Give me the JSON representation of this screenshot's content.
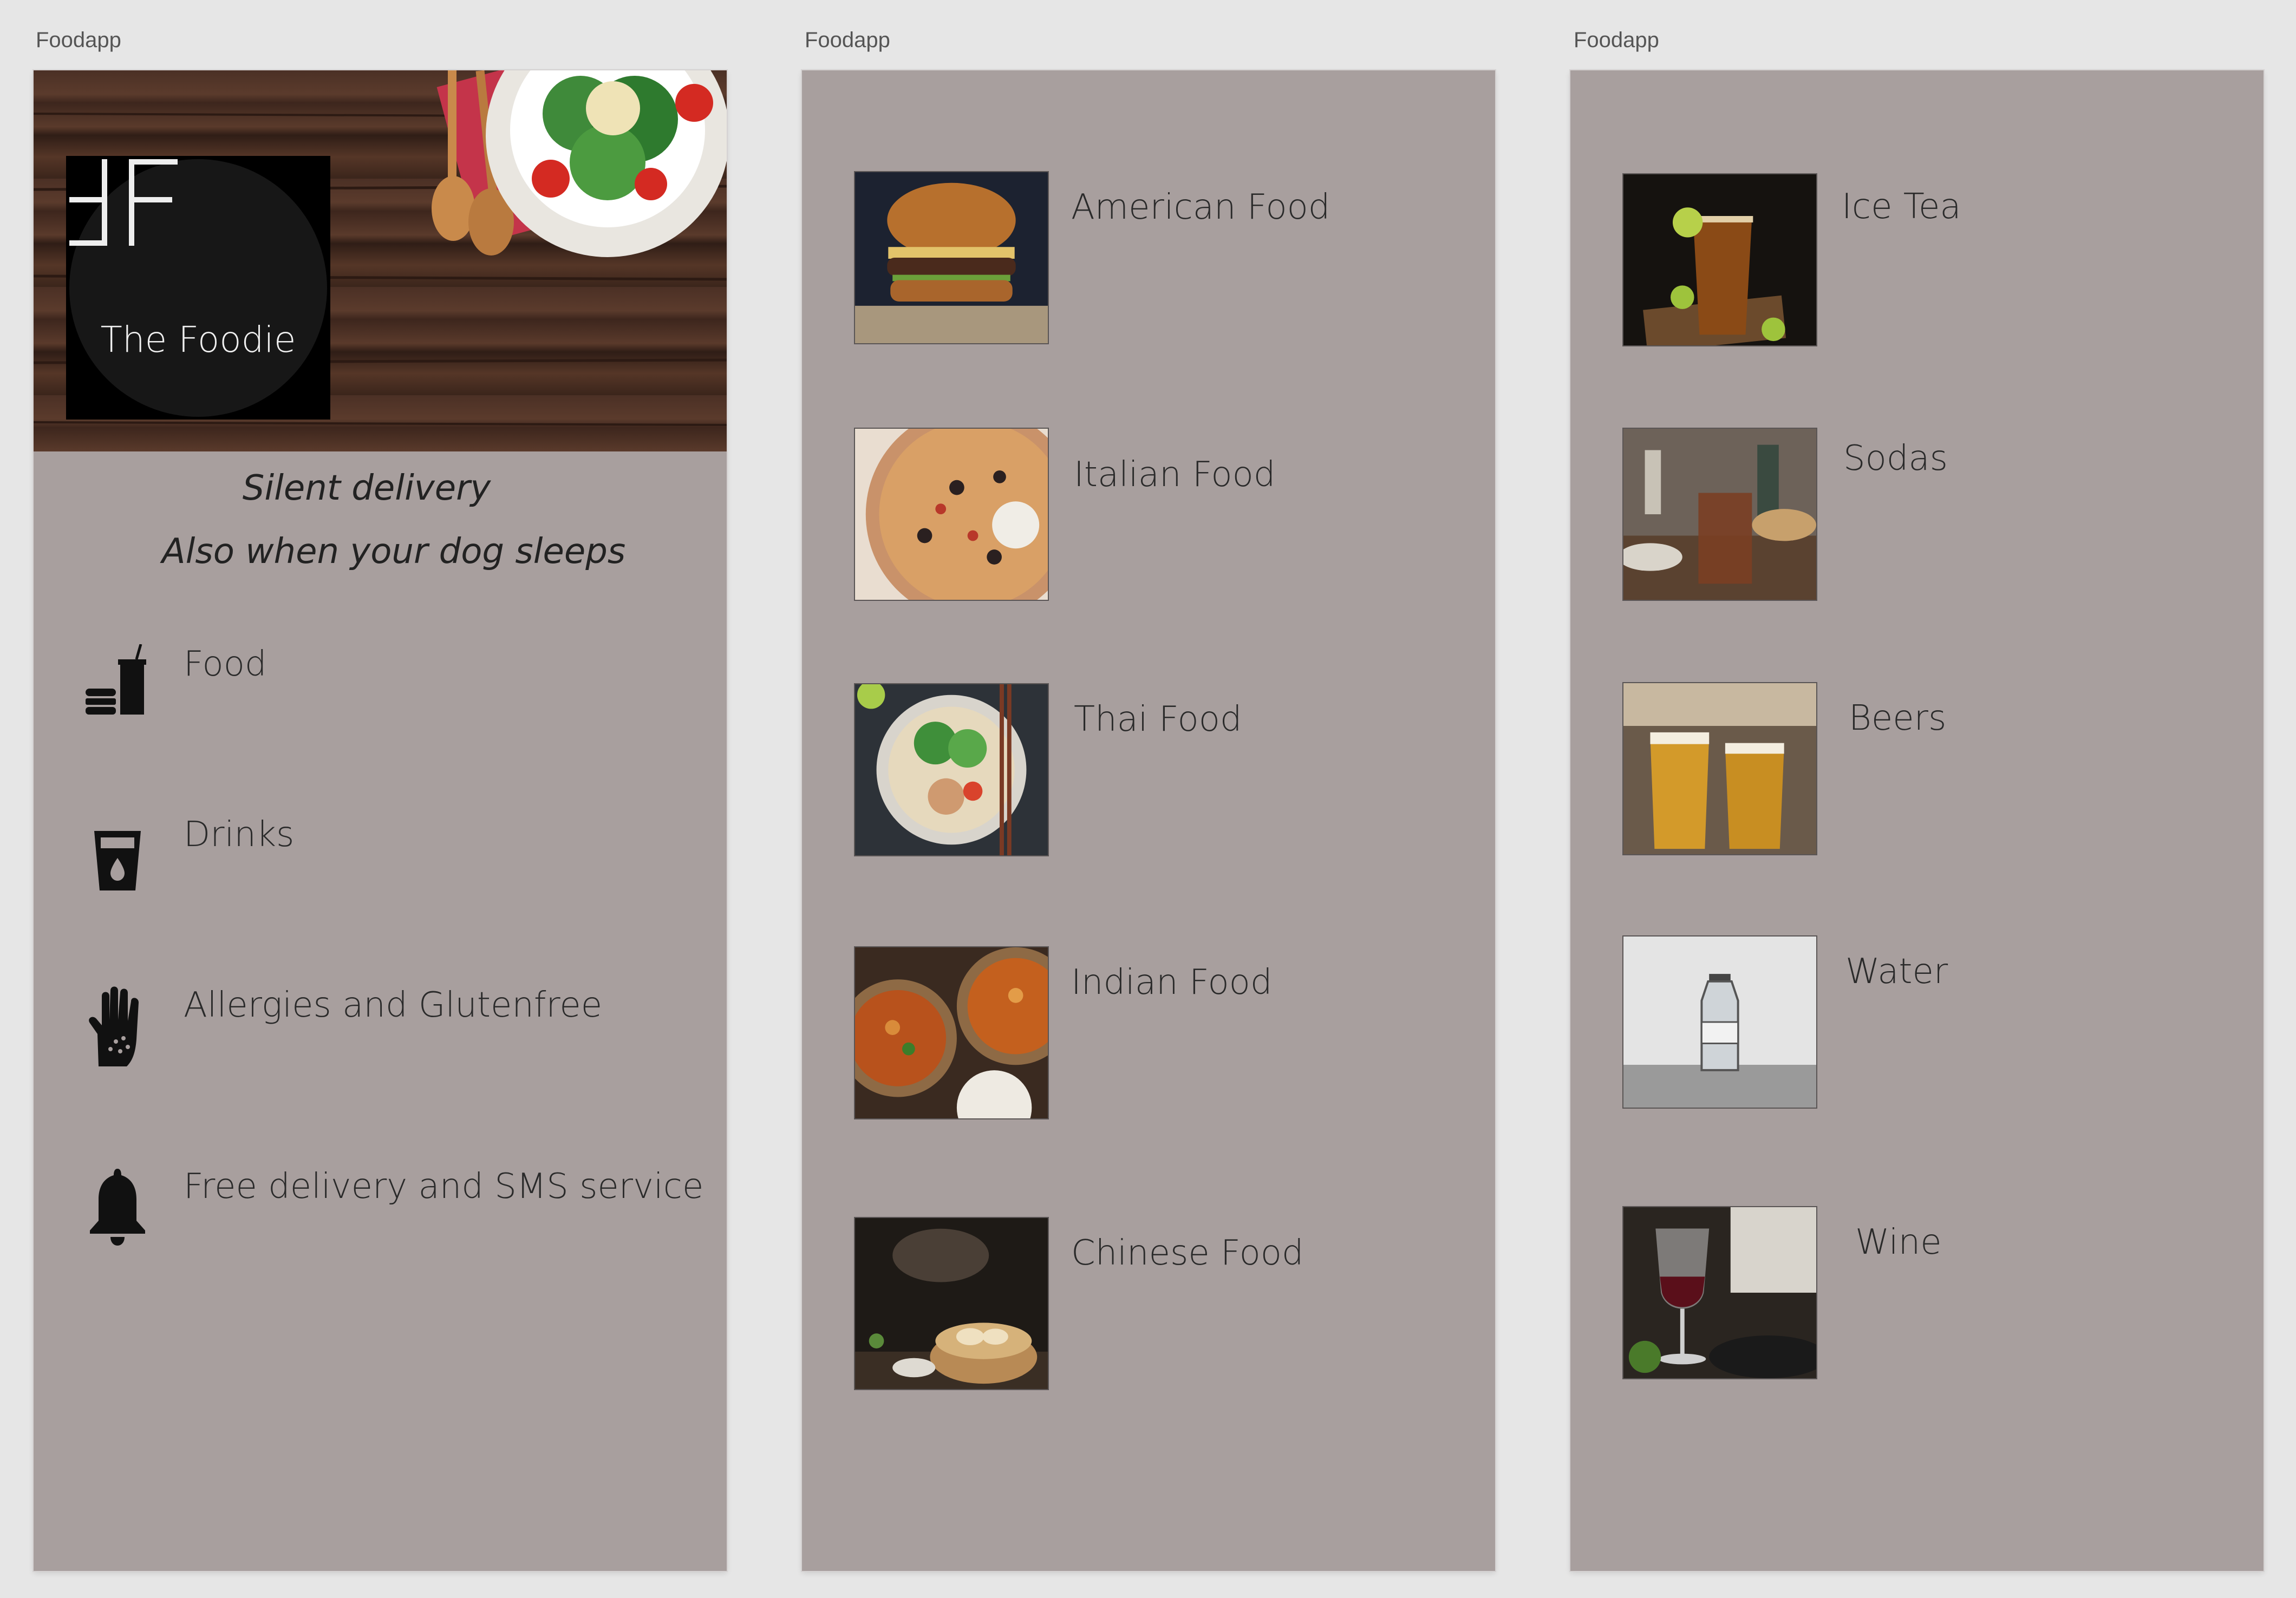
{
  "artboards": [
    {
      "title": "Foodapp"
    },
    {
      "title": "Foodapp"
    },
    {
      "title": "Foodapp"
    }
  ],
  "home": {
    "logo_text": "The Foodie",
    "tagline_1": "Silent delivery",
    "tagline_2": "Also when your dog sleeps",
    "menu": [
      {
        "label": "Food",
        "icon": "fast-food-icon"
      },
      {
        "label": "Drinks",
        "icon": "cup-icon"
      },
      {
        "label": "Allergies and Glutenfree",
        "icon": "hand-icon"
      },
      {
        "label": "Free delivery and SMS service",
        "icon": "bell-icon"
      }
    ]
  },
  "food": {
    "items": [
      {
        "label": "American Food",
        "image": "burger"
      },
      {
        "label": "Italian Food",
        "image": "pizza"
      },
      {
        "label": "Thai Food",
        "image": "noodle-bowl"
      },
      {
        "label": "Indian Food",
        "image": "curry"
      },
      {
        "label": "Chinese Food",
        "image": "dumplings"
      }
    ]
  },
  "drinks": {
    "items": [
      {
        "label": "Ice Tea",
        "image": "ice-tea"
      },
      {
        "label": "Sodas",
        "image": "sodas"
      },
      {
        "label": "Beers",
        "image": "beers"
      },
      {
        "label": "Water",
        "image": "water-bottle"
      },
      {
        "label": "Wine",
        "image": "wine-glass"
      }
    ]
  },
  "colors": {
    "canvas": "#e6e6e6",
    "artboard": "#a89f9e",
    "text": "#2a2a2a"
  }
}
